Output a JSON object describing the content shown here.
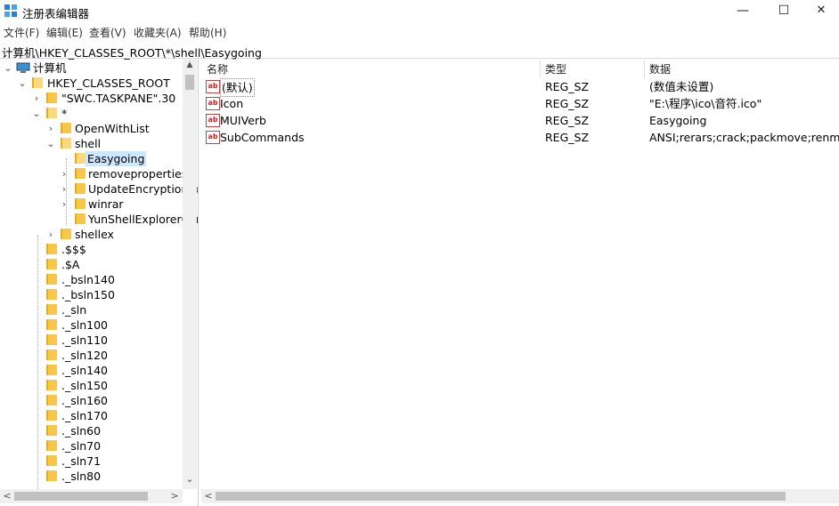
{
  "window": {
    "title": "注册表编辑器",
    "minimize": "—",
    "maximize": "☐",
    "close": "✕"
  },
  "menu": [
    "文件(F)",
    "编辑(E)",
    "查看(V)",
    "收藏夹(A)",
    "帮助(H)"
  ],
  "address": "计算机\\HKEY_CLASSES_ROOT\\*\\shell\\Easygoing",
  "tree": [
    {
      "label": "计算机",
      "chevron": "⌄"
    },
    {
      "label": "HKEY_CLASSES_ROOT",
      "chevron": "⌄"
    },
    {
      "label": "\"SWC.TASKPANE\".30",
      "chevron": "›"
    },
    {
      "label": "*",
      "chevron": "⌄"
    },
    {
      "label": "OpenWithList",
      "chevron": "›"
    },
    {
      "label": "shell",
      "chevron": "⌄"
    },
    {
      "label": "Easygoing",
      "chevron": ""
    },
    {
      "label": "removeproperties",
      "chevron": "›"
    },
    {
      "label": "UpdateEncryptionSettings",
      "chevron": "›"
    },
    {
      "label": "winrar",
      "chevron": "›"
    },
    {
      "label": "YunShellExplorerCommand",
      "chevron": ""
    },
    {
      "label": "shellex",
      "chevron": "›"
    },
    {
      "label": ".$$$",
      "chevron": ""
    },
    {
      "label": ".$A",
      "chevron": ""
    },
    {
      "label": "._bsln140",
      "chevron": ""
    },
    {
      "label": "._bsln150",
      "chevron": ""
    },
    {
      "label": "._sln",
      "chevron": ""
    },
    {
      "label": "._sln100",
      "chevron": ""
    },
    {
      "label": "._sln110",
      "chevron": ""
    },
    {
      "label": "._sln120",
      "chevron": ""
    },
    {
      "label": "._sln140",
      "chevron": ""
    },
    {
      "label": "._sln150",
      "chevron": ""
    },
    {
      "label": "._sln160",
      "chevron": ""
    },
    {
      "label": "._sln170",
      "chevron": ""
    },
    {
      "label": "._sln60",
      "chevron": ""
    },
    {
      "label": "._sln70",
      "chevron": ""
    },
    {
      "label": "._sln71",
      "chevron": ""
    },
    {
      "label": "._sln80",
      "chevron": ""
    }
  ],
  "columns": {
    "name": "名称",
    "type": "类型",
    "data": "数据"
  },
  "values": [
    {
      "icon": "ab",
      "name": "(默认)",
      "type": "REG_SZ",
      "data": "(数值未设置)"
    },
    {
      "icon": "ab",
      "name": "Icon",
      "type": "REG_SZ",
      "data": "\"E:\\程序\\ico\\音符.ico\""
    },
    {
      "icon": "ab",
      "name": "MUIVerb",
      "type": "REG_SZ",
      "data": "Easygoing"
    },
    {
      "icon": "ab",
      "name": "SubCommands",
      "type": "REG_SZ",
      "data": "ANSI;rerars;crack;packmove;renmusic"
    }
  ],
  "scroll_arrows": {
    "up": "▲",
    "down": "⌄",
    "left": "<",
    "right": ">"
  },
  "colors": {
    "selection": "#cce8ff",
    "folder": "#f6c74a",
    "scrollbar_thumb": "#c1c1c1"
  }
}
